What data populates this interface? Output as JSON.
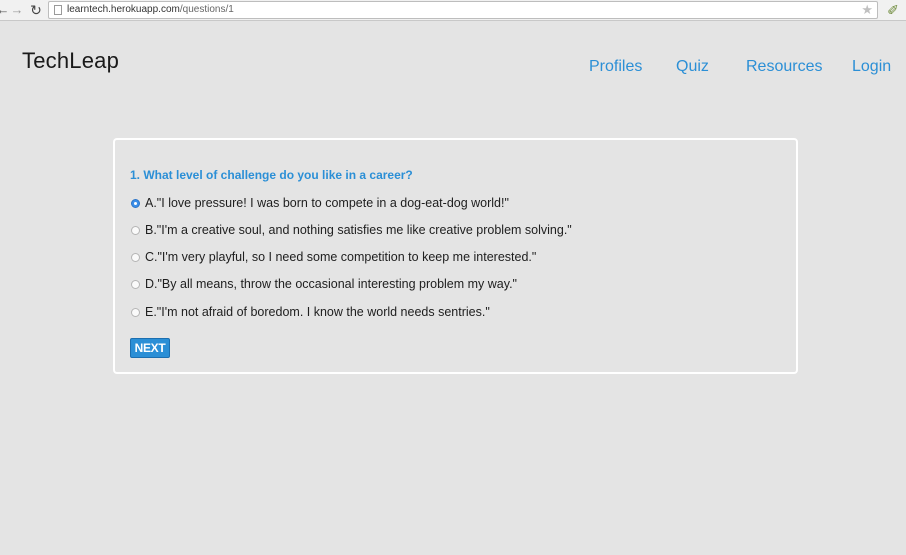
{
  "browser": {
    "url_host": "learntech.herokuapp.com",
    "url_path": "/questions/1",
    "back_glyph": "←",
    "forward_glyph": "→",
    "reload_glyph": "↻",
    "star_glyph": "★",
    "extension_glyph": "✐"
  },
  "site": {
    "logo": "TechLeap",
    "nav": [
      "Profiles",
      "Quiz",
      "Resources",
      "Login"
    ],
    "accent_color": "#2b8fd6"
  },
  "quiz": {
    "question": "1. What level of challenge do you like in a career?",
    "selected_index": 0,
    "options": [
      "A.\"I love pressure! I was born to compete in a dog-eat-dog world!\"",
      "B.\"I'm a creative soul, and nothing satisfies me like creative problem solving.\"",
      "C.\"I'm very playful, so I need some competition to keep me interested.\"",
      "D.\"By all means, throw the occasional interesting problem my way.\"",
      "E.\"I'm not afraid of boredom. I know the world needs sentries.\""
    ],
    "next_label": "NEXT"
  }
}
